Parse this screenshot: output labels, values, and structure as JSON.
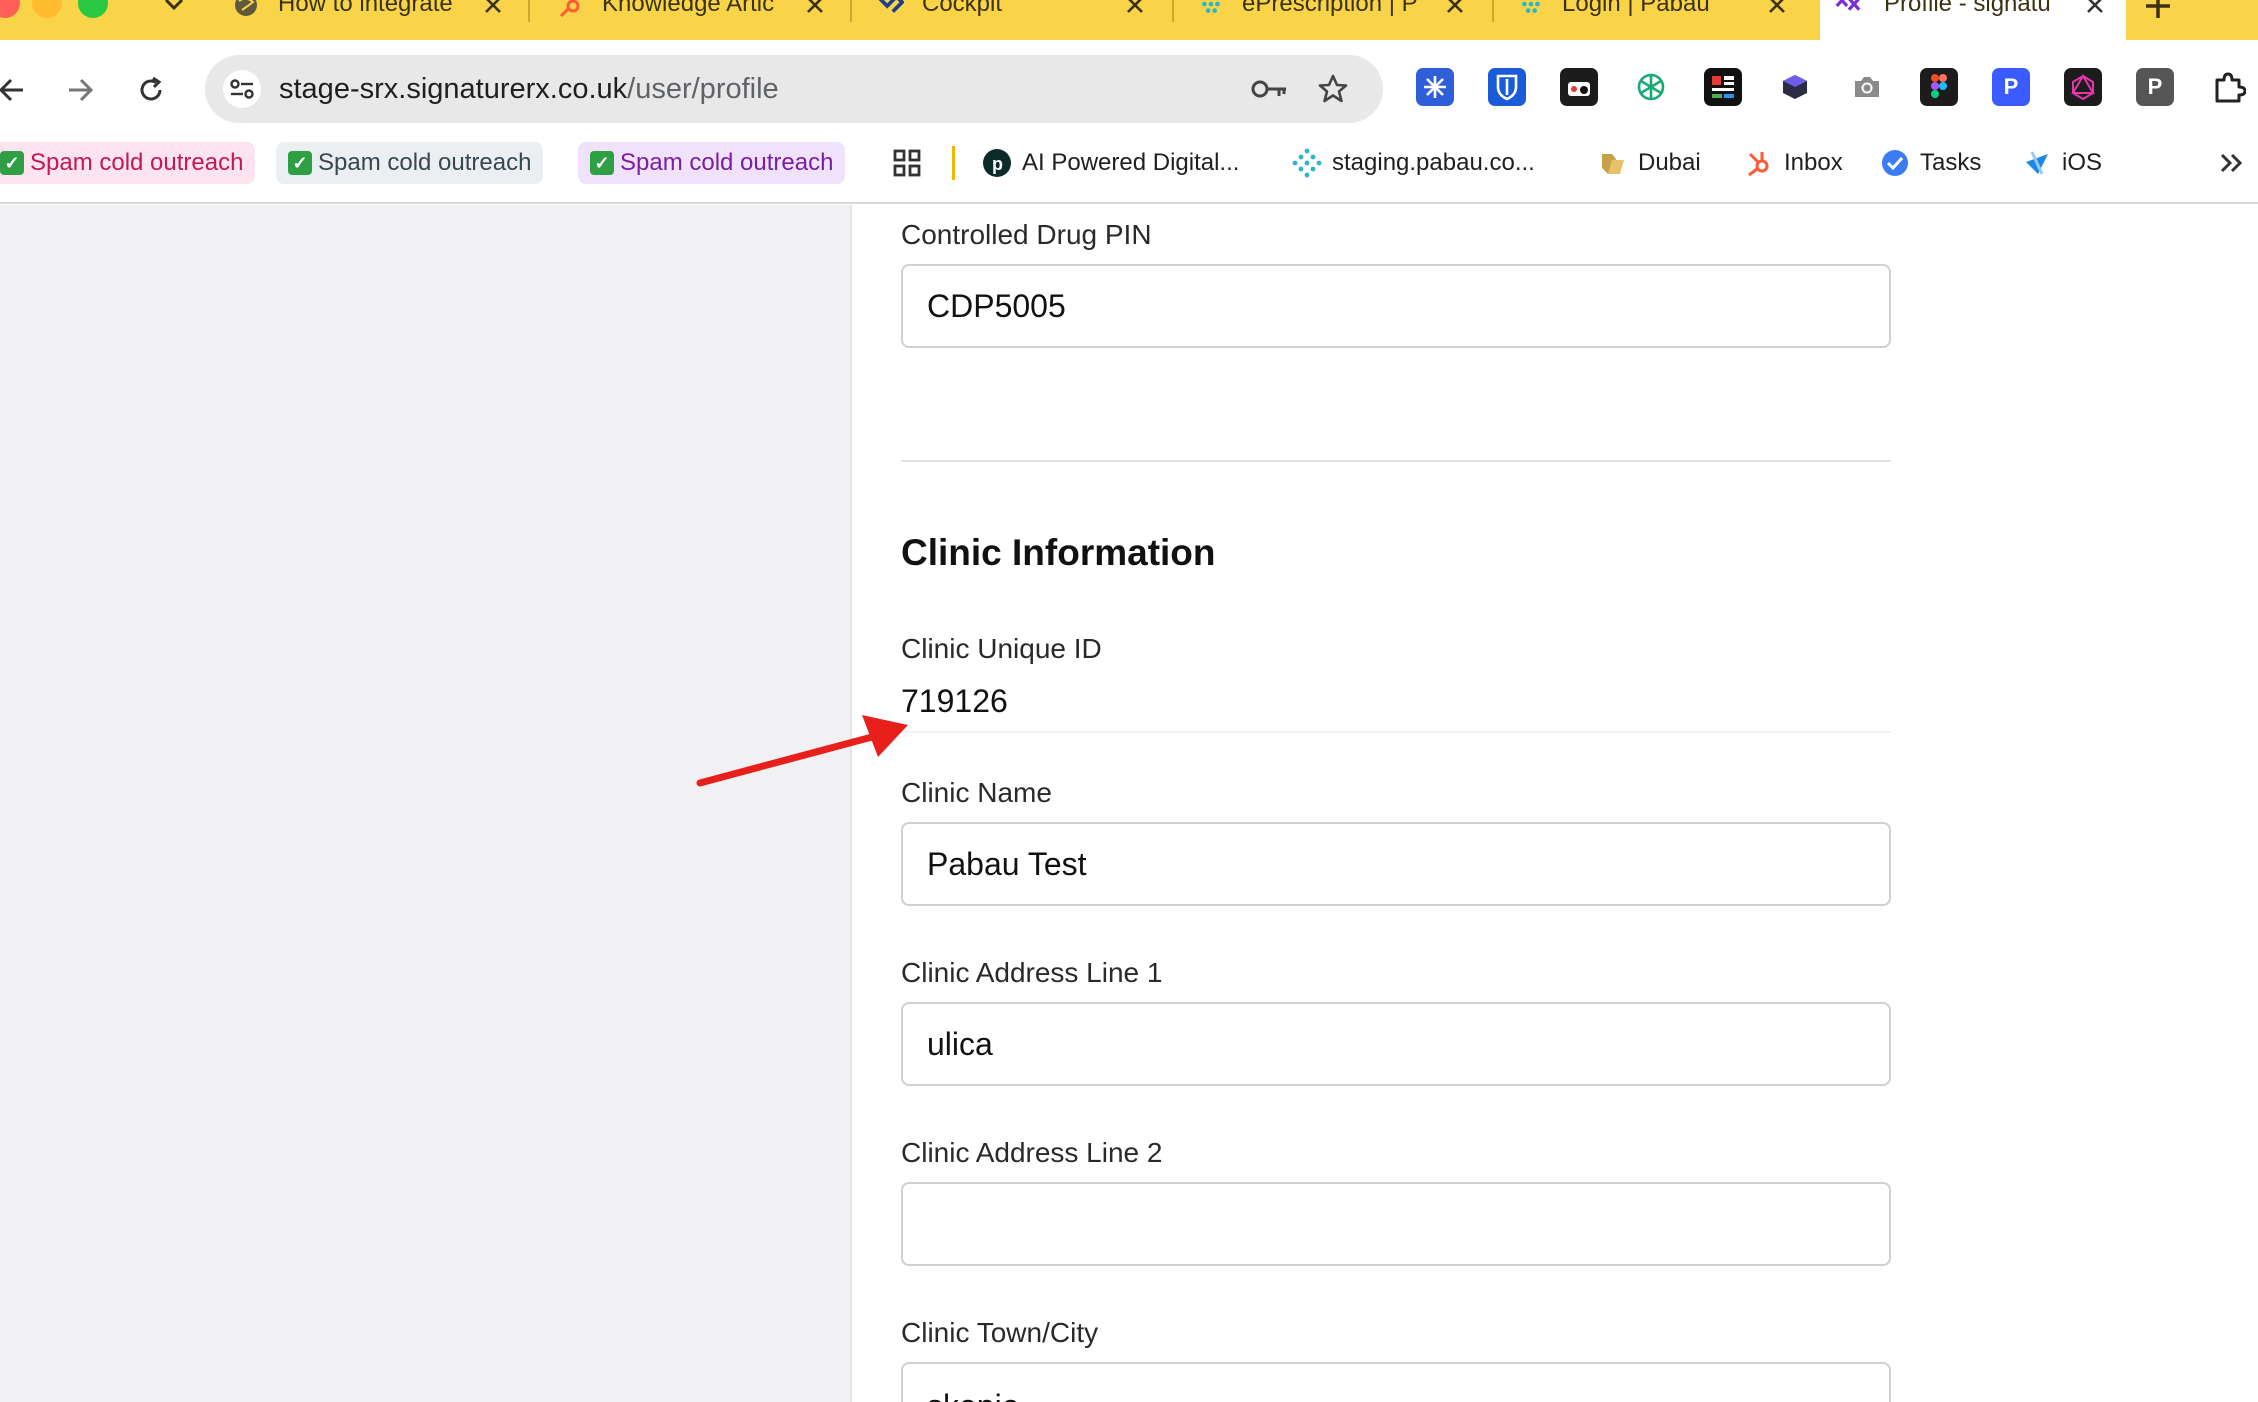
{
  "browser": {
    "tabs": [
      {
        "title": "How to integrate",
        "favicon": "globe-icon"
      },
      {
        "title": "Knowledge Artic",
        "favicon": "hubspot-icon"
      },
      {
        "title": "Cockpit",
        "favicon": "cockpit-icon"
      },
      {
        "title": "ePrescription | P",
        "favicon": "pabau-icon"
      },
      {
        "title": "Login | Pabau",
        "favicon": "pabau-icon"
      },
      {
        "title": "Profile - signatu",
        "favicon": "signaturerx-icon"
      }
    ],
    "url": {
      "host": "stage-srx.signaturerx.co.uk",
      "path": "/user/profile"
    },
    "extensions": [
      "snowflake-icon",
      "bitwarden-icon",
      "ext-dots-icon",
      "openai-icon",
      "board-icon",
      "cube-icon",
      "camera-icon",
      "figma-icon",
      "p-blue-icon",
      "graphql-icon",
      "p-grey-icon",
      "puzzle-icon"
    ],
    "bookmarks": [
      {
        "label": "Spam cold outreach",
        "color": "#c2185b"
      },
      {
        "label": "Spam cold outreach",
        "color": "#37474f"
      },
      {
        "label": "Spam cold outreach",
        "color": "#7b1fa2"
      },
      {
        "label": "AI Powered Digital...",
        "icon": "p-circle-icon"
      },
      {
        "label": "staging.pabau.co...",
        "icon": "pabau-icon"
      },
      {
        "label": "Dubai",
        "icon": "folder-icon"
      },
      {
        "label": "Inbox",
        "icon": "hubspot-icon"
      },
      {
        "label": "Tasks",
        "icon": "check-circle-icon"
      },
      {
        "label": "iOS",
        "icon": "xcode-icon"
      }
    ]
  },
  "form": {
    "controlled_drug_pin": {
      "label": "Controlled Drug PIN",
      "value": "CDP5005"
    },
    "clinic_section_title": "Clinic Information",
    "clinic_unique_id": {
      "label": "Clinic Unique ID",
      "value": "719126"
    },
    "clinic_name": {
      "label": "Clinic Name",
      "value": "Pabau Test"
    },
    "clinic_address_1": {
      "label": "Clinic Address Line 1",
      "value": "ulica"
    },
    "clinic_address_2": {
      "label": "Clinic Address Line 2",
      "value": ""
    },
    "clinic_town": {
      "label": "Clinic Town/City",
      "value": "skopje"
    }
  },
  "colors": {
    "tab_strip": "#f9d449",
    "annotation_arrow": "#e8201c"
  }
}
